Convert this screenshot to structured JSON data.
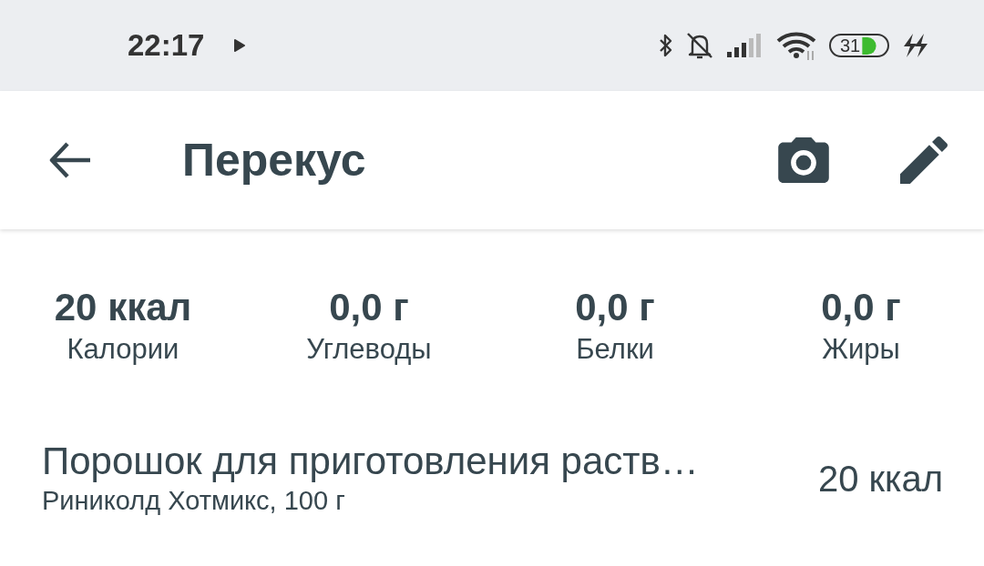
{
  "status_bar": {
    "time": "22:17",
    "battery": "31"
  },
  "app_bar": {
    "title": "Перекус"
  },
  "summary": [
    {
      "value": "20 ккал",
      "label": "Калории"
    },
    {
      "value": "0,0 г",
      "label": "Углеводы"
    },
    {
      "value": "0,0 г",
      "label": "Белки"
    },
    {
      "value": "0,0 г",
      "label": "Жиры"
    }
  ],
  "entries": [
    {
      "name": "Порошок для приготовления раств…",
      "details": "Риниколд Хотмикс, 100 г",
      "calories": "20 ккал"
    }
  ]
}
